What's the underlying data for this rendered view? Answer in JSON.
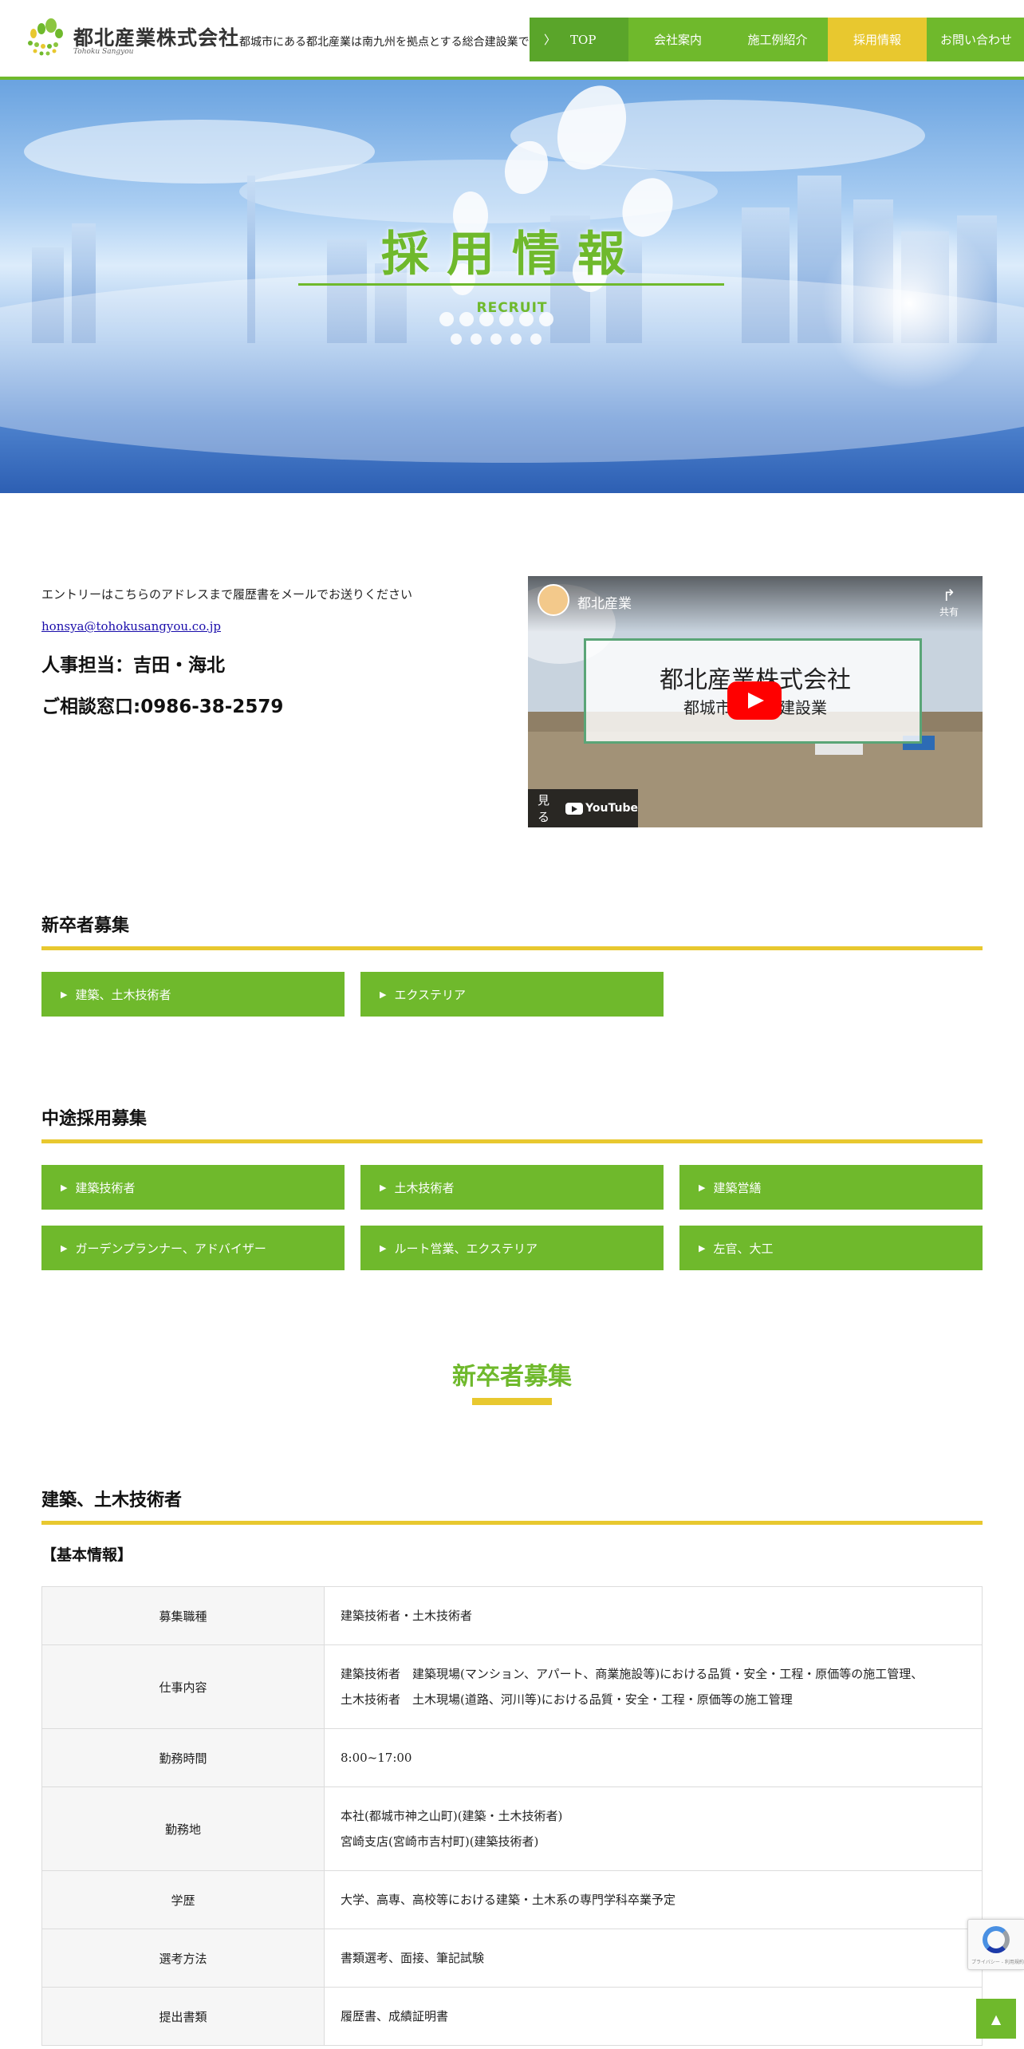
{
  "header": {
    "logo_name": "都北産業株式会社",
    "logo_sub": "Tohoku Sangyou",
    "tagline": "都城市にある都北産業は南九州を拠点とする総合建設業で",
    "nav": [
      {
        "label": "TOP",
        "chevron": "〉"
      },
      {
        "label": "会社案内"
      },
      {
        "label": "施工例紹介"
      },
      {
        "label": "採用情報",
        "active": true
      },
      {
        "label": "お問い合わせ"
      }
    ]
  },
  "hero": {
    "title": "採用情報",
    "subtitle": "RECRUIT"
  },
  "entry": {
    "text": "エントリーはこちらのアドレスまで履歴書をメールでお送りください",
    "email": "honsya@tohokusangyou.co.jp",
    "hr": "人事担当：吉田・海北",
    "tel": "ご相談窓口:0986-38-2579"
  },
  "video": {
    "channel": "都北産業",
    "share_label": "共有",
    "card_title": "都北産業株式会社",
    "card_sub": "都城市　　　建設業",
    "watch_label": "見る",
    "yt_label": "YouTube"
  },
  "new_grad": {
    "heading": "新卒者募集",
    "buttons": [
      "建築、土木技術者",
      "エクステリア"
    ]
  },
  "mid_career": {
    "heading": "中途採用募集",
    "buttons": [
      "建築技術者",
      "土木技術者",
      "建築営繕",
      "ガーデンプランナー、アドバイザー",
      "ルート営業、エクステリア",
      "左官、大工"
    ]
  },
  "detail": {
    "title": "新卒者募集",
    "section_heading": "建築、土木技術者",
    "sub_heading": "【基本情報】",
    "rows": [
      {
        "key": "募集職種",
        "lines": [
          "建築技術者・土木技術者"
        ]
      },
      {
        "key": "仕事内容",
        "lines": [
          "建築技術者　建築現場(マンション、アパート、商業施設等)における品質・安全・工程・原価等の施工管理、",
          "土木技術者　土木現場(道路、河川等)における品質・安全・工程・原価等の施工管理"
        ]
      },
      {
        "key": "勤務時間",
        "lines": [
          "8:00~17:00"
        ]
      },
      {
        "key": "勤務地",
        "lines": [
          "本社(都城市神之山町)(建築・土木技術者)",
          "宮崎支店(宮崎市吉村町)(建築技術者)"
        ]
      },
      {
        "key": "学歴",
        "lines": [
          "大学、高専、高校等における建築・土木系の専門学科卒業予定"
        ]
      },
      {
        "key": "選考方法",
        "lines": [
          "書類選考、面接、筆記試験"
        ]
      },
      {
        "key": "提出書類",
        "lines": [
          "履歴書、成績証明書"
        ]
      }
    ]
  },
  "widgets": {
    "recaptcha_text": "プライバシー - 利用規約",
    "pagetop": "▲"
  },
  "colors": {
    "green": "#6fb92c",
    "yellow": "#e8c82f"
  }
}
